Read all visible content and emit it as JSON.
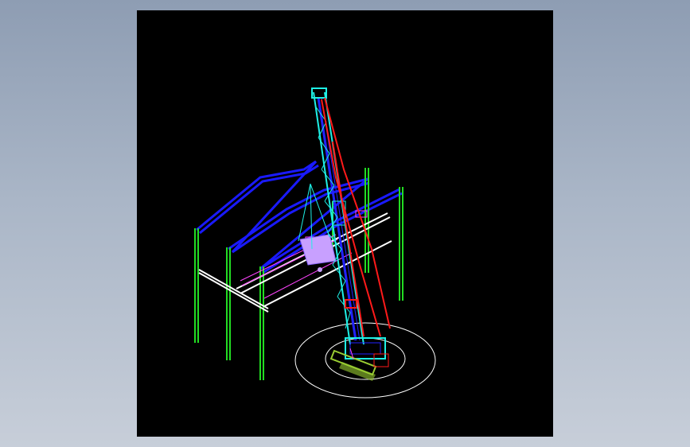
{
  "drawing": {
    "background_color": "#000000",
    "page_background_color": "#a7b3c4",
    "colors": {
      "columns": "#22dd22",
      "roof_beams": "#1a1aff",
      "rails": "#ffffff",
      "boom": "#1ef0e6",
      "boom_inner": "#2222ff",
      "cables": "#ff1a1a",
      "load": "#c8a0ff",
      "crawler_tracks": "#9acd32",
      "swing_circle": "#ffffff",
      "magenta": "#ff44ff"
    },
    "components": [
      "steel-frame-columns",
      "roof-beams",
      "crane-runway-rails",
      "crawler-crane-boom",
      "hoist-cables",
      "suspended-load",
      "crawler-base",
      "swing-radius-circles"
    ]
  }
}
